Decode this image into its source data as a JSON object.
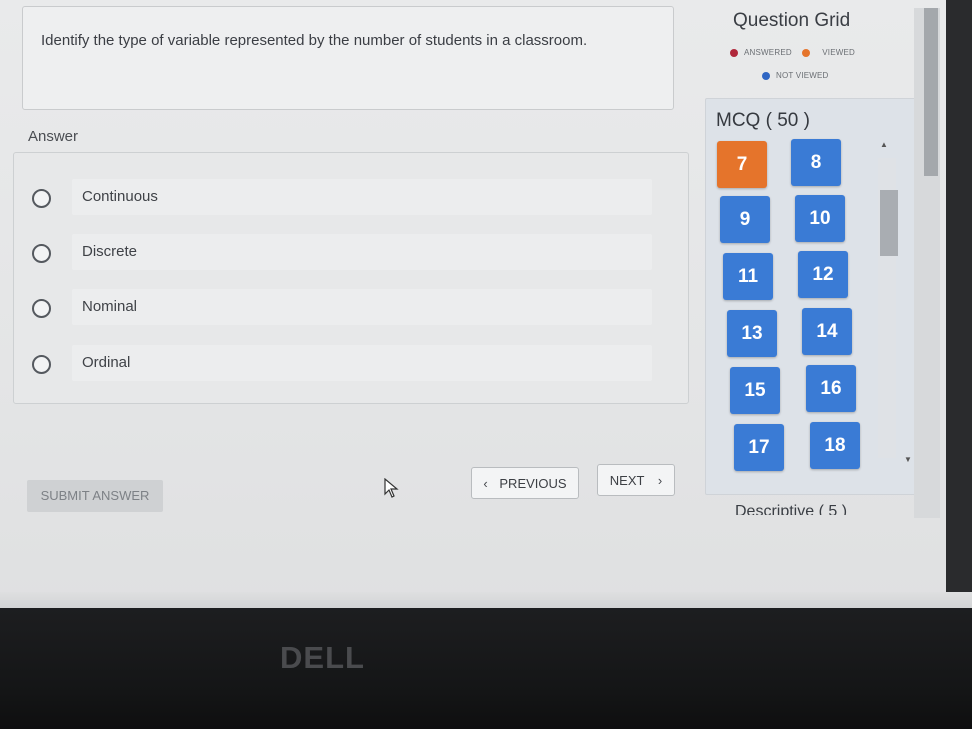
{
  "question": {
    "text": "Identify the type of variable represented by the number of students in a classroom."
  },
  "answer": {
    "title": "Answer",
    "options": [
      {
        "label": "Continuous",
        "selected": false
      },
      {
        "label": "Discrete",
        "selected": false
      },
      {
        "label": "Nominal",
        "selected": false
      },
      {
        "label": "Ordinal",
        "selected": false
      }
    ]
  },
  "buttons": {
    "submit": "SUBMIT ANSWER",
    "previous": "PREVIOUS",
    "next": "NEXT"
  },
  "question_grid": {
    "title": "Question Grid",
    "legend": {
      "answered": "ANSWERED",
      "viewed": "VIEWED",
      "not_viewed": "NOT VIEWED"
    },
    "legend_colors": {
      "answered": "#b0283b",
      "viewed": "#e5742b",
      "not_viewed": "#2f66c4"
    },
    "section_title": "MCQ ( 50 )",
    "tiles": [
      {
        "num": "7",
        "status": "viewed"
      },
      {
        "num": "8",
        "status": "not_viewed"
      },
      {
        "num": "9",
        "status": "not_viewed"
      },
      {
        "num": "10",
        "status": "not_viewed"
      },
      {
        "num": "11",
        "status": "not_viewed"
      },
      {
        "num": "12",
        "status": "not_viewed"
      },
      {
        "num": "13",
        "status": "not_viewed"
      },
      {
        "num": "14",
        "status": "not_viewed"
      },
      {
        "num": "15",
        "status": "not_viewed"
      },
      {
        "num": "16",
        "status": "not_viewed"
      },
      {
        "num": "17",
        "status": "not_viewed"
      },
      {
        "num": "18",
        "status": "not_viewed"
      }
    ],
    "tile_colors": {
      "viewed": "#e5742b",
      "not_viewed": "#3a7bd5"
    },
    "next_section": "Descriptive ( 5 )"
  },
  "device": {
    "brand": "DELL"
  },
  "icons": {
    "cursor": "mouse-pointer-icon",
    "prev": "chevron-left-icon",
    "next": "chevron-right-icon"
  }
}
